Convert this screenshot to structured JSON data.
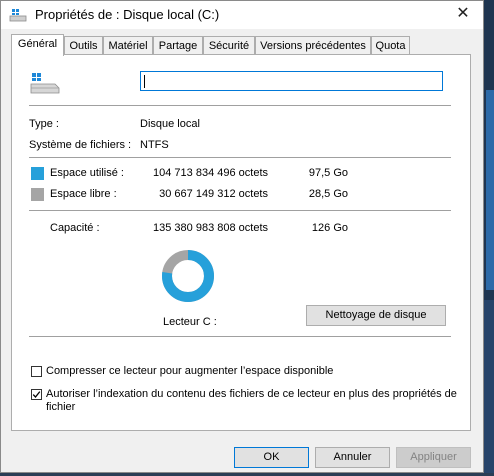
{
  "window": {
    "title": "Propriétés de : Disque local (C:)"
  },
  "tabs": [
    {
      "label": "Général",
      "active": true
    },
    {
      "label": "Outils"
    },
    {
      "label": "Matériel"
    },
    {
      "label": "Partage"
    },
    {
      "label": "Sécurité"
    },
    {
      "label": "Versions précédentes"
    },
    {
      "label": "Quota"
    }
  ],
  "drive": {
    "name_value": ""
  },
  "info": {
    "type_label": "Type :",
    "type_value": "Disque local",
    "fs_label": "Système de fichiers :",
    "fs_value": "NTFS"
  },
  "usage": {
    "used_label": "Espace utilisé :",
    "used_bytes": "104 713 834 496 octets",
    "used_gb": "97,5 Go",
    "free_label": "Espace libre :",
    "free_bytes": "30 667 149 312 octets",
    "free_gb": "28,5 Go",
    "capacity_label": "Capacité :",
    "capacity_bytes": "135 380 983 808 octets",
    "capacity_gb": "126 Go",
    "used_fraction": 0.7735,
    "used_color": "#26a0da",
    "free_color": "#a5a5a5"
  },
  "drive_label": "Lecteur C :",
  "cleanup_button": "Nettoyage de disque",
  "options": {
    "compress_label": "Compresser ce lecteur pour augmenter l’espace disponible",
    "compress_checked": false,
    "index_label_line1": "Autoriser l’indexation du contenu des fichiers de ce lecteur en plus des propriétés de",
    "index_label_line2": "fichier",
    "index_checked": true
  },
  "buttons": {
    "ok": "OK",
    "cancel": "Annuler",
    "apply": "Appliquer"
  }
}
